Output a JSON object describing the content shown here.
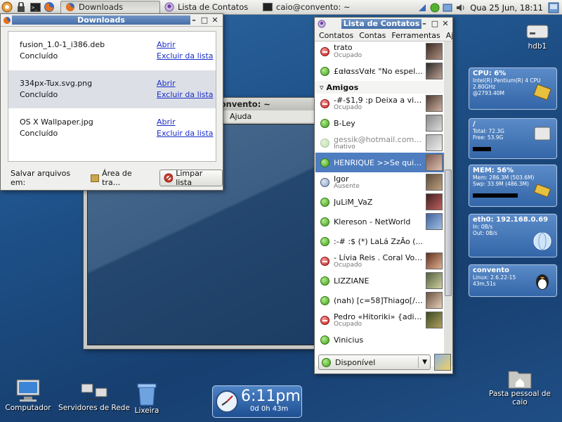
{
  "panel": {
    "tasks": [
      {
        "label": "Downloads",
        "active": true
      },
      {
        "label": "Lista de Contatos",
        "active": false
      },
      {
        "label": "caio@convento: ~",
        "active": false
      }
    ],
    "clock": "Qua 25 Jun, 18:11"
  },
  "downloads": {
    "title": "Downloads",
    "items": [
      {
        "name": "fusion_1.0-1_i386.deb",
        "status": "Concluído",
        "open": "Abrir",
        "remove": "Excluir da lista"
      },
      {
        "name": "334px-Tux.svg.png",
        "status": "Concluído",
        "open": "Abrir",
        "remove": "Excluir da lista"
      },
      {
        "name": "OS X Wallpaper.jpg",
        "status": "Concluído",
        "open": "Abrir",
        "remove": "Excluir da lista"
      }
    ],
    "save_label": "Salvar arquivos em:",
    "save_folder": "Área de tra...",
    "clear_label": "Limpar lista"
  },
  "terminal": {
    "title": "caio@convento: ~",
    "menu_help": "Ajuda"
  },
  "contacts": {
    "title": "Lista de Contatos",
    "menu": [
      "Contatos",
      "Contas",
      "Ferramentas",
      "Aj"
    ],
    "top_rows": [
      {
        "name": "trato",
        "sub": "Ocupado",
        "status": "busy"
      },
      {
        "name": "£αłαssVαłε \"No espel...",
        "sub": "",
        "status": "online"
      }
    ],
    "group": "Amigos",
    "rows": [
      {
        "name": "-#-$1,9 :p Deixa a vida...",
        "sub": "Ocupado",
        "status": "busy"
      },
      {
        "name": "B-Ley",
        "sub": "",
        "status": "online"
      },
      {
        "name": "gessik@hotmail.com.b...",
        "sub": "Inativo",
        "status": "offline"
      },
      {
        "name": "HENRIQUE  >>Se quis...",
        "sub": "",
        "status": "online",
        "selected": true
      },
      {
        "name": "Igor",
        "sub": "Ausente",
        "status": "away"
      },
      {
        "name": "JuLiM_VaZ",
        "sub": "",
        "status": "online"
      },
      {
        "name": "Klereson - NetWorld",
        "sub": "",
        "status": "online"
      },
      {
        "name": ":-# :$ (*)  LaLá ZzÃo (...",
        "sub": "",
        "status": "online"
      },
      {
        "name": "- Lívia Reis . Coral Voix-...",
        "sub": "Ocupado",
        "status": "busy"
      },
      {
        "name": "LIZZIANE",
        "sub": "",
        "status": "online"
      },
      {
        "name": "(nah) [c=58]Thiago[/c]...",
        "sub": "",
        "status": "online"
      },
      {
        "name": "Pedro «Hitoriki» {adiós...",
        "sub": "Ocupado",
        "status": "busy"
      },
      {
        "name": "Vinicius",
        "sub": "",
        "status": "online"
      }
    ],
    "status_select": "Disponível"
  },
  "monitors": {
    "cpu": {
      "title": "CPU:  6%",
      "lines": [
        "Intel(R) Pentium(R) 4 CPU",
        "2.80GHz",
        "@2793.40M"
      ]
    },
    "disk": {
      "title": "/",
      "lines": [
        "Total:  72.3G",
        "Free:  53.9G"
      ]
    },
    "mem": {
      "title": "MEM:  56%",
      "lines": [
        "Mem: 286.3M (503.6M)",
        "Swp: 33.9M (486.3M)"
      ]
    },
    "net": {
      "title": "eth0:  192.168.0.69",
      "lines": [
        "In:      0B/s",
        "Out:    0B/s"
      ]
    },
    "host": {
      "title": "convento",
      "lines": [
        "Linux: 2.6.22-15",
        "43m,51s"
      ]
    }
  },
  "desktop": {
    "hdb1": "hdb1",
    "computer": "Computador",
    "network": "Servidores de Rede",
    "trash": "Lixeira",
    "home": "Pasta pessoal de caio"
  },
  "clock_widget": {
    "time": "6:11pm",
    "uptime": "0d 0h 43m"
  },
  "colors": {
    "accent": "#4e7dc0",
    "desktop": "#1d4f86",
    "link": "#1a2ec8"
  }
}
